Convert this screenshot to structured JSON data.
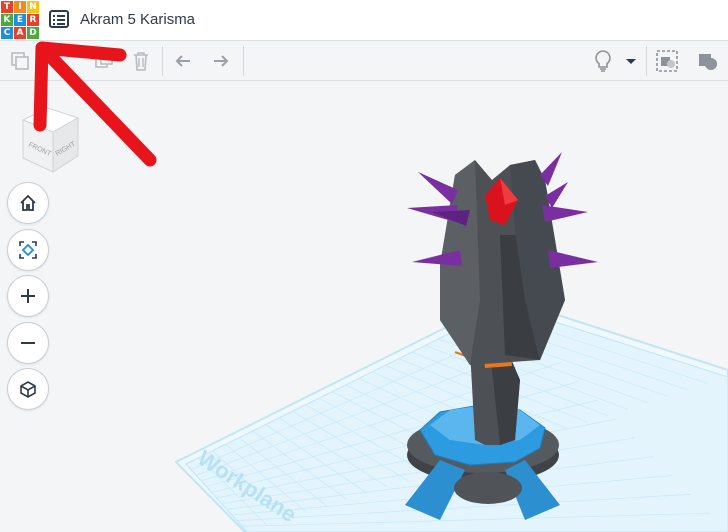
{
  "app": {
    "logo_letters": [
      "T",
      "I",
      "N",
      "K",
      "E",
      "R",
      "C",
      "A",
      "D"
    ],
    "logo_colors": [
      "#e8412b",
      "#f08b1d",
      "#f7c21c",
      "#4da83d",
      "#1f8ee0",
      "#e8412b",
      "#1f8ee0",
      "#e8412b",
      "#4da83d"
    ]
  },
  "project": {
    "title": "Akram 5 Karisma"
  },
  "toolbar": {
    "items": [
      "copy-icon",
      "paste-icon",
      "duplicate-icon",
      "delete-icon",
      "undo-icon",
      "redo-icon",
      "light-bulb-icon",
      "dropdown-caret-icon",
      "notes-icon",
      "shape-icon"
    ]
  },
  "viewcube": {
    "front_label": "FRONT",
    "right_label": "RIGHT"
  },
  "nav_controls": [
    "home-icon",
    "fit-view-icon",
    "zoom-in-icon",
    "zoom-out-icon",
    "ortho-view-icon"
  ],
  "workplane": {
    "label": "Workplane"
  },
  "colors": {
    "annotation_arrow": "#e8141b",
    "grid": "#bfe6f7",
    "model_gray": "#505458",
    "spikes": "#7a2fa0",
    "gem": "#d9131e",
    "blue_base": "#2c9be0",
    "orange_block": "#e9781a"
  }
}
